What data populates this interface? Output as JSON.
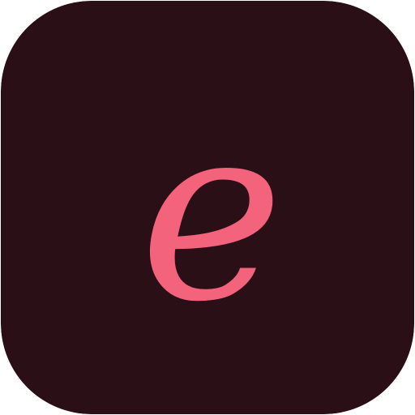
{
  "icon": {
    "name": "e-letter-app-icon",
    "glyph": "e",
    "colors": {
      "background": "#2a0f17",
      "glyph": "#f4637c"
    }
  }
}
